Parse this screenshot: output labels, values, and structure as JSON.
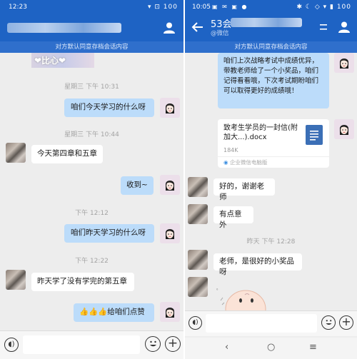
{
  "left": {
    "status": {
      "time": "12:23",
      "icons": "▾ ⊡ 100"
    },
    "banner": "对方默认同意存档会话内容",
    "image_fragment_text": "❤比心❤",
    "messages": [
      {
        "type": "time",
        "text": "星期三 下午 10:31"
      },
      {
        "type": "me",
        "text": "咱们今天学习的什么呀"
      },
      {
        "type": "time",
        "text": "星期三 下午 10:44"
      },
      {
        "type": "them",
        "text": "今天第四章和五章"
      },
      {
        "type": "me",
        "text": "收到~"
      },
      {
        "type": "time",
        "text": "下午 12:12"
      },
      {
        "type": "me",
        "text": "咱们昨天学习的什么呀"
      },
      {
        "type": "time",
        "text": "下午 12:22"
      },
      {
        "type": "them",
        "text": "昨天学了没有学完的第五章"
      },
      {
        "type": "me",
        "text": "👍👍👍给咱们点赞"
      }
    ]
  },
  "right": {
    "status": {
      "time": "10:05",
      "icons": "✱ ☾ ◇ ▾ ▮ 100"
    },
    "title": "53会",
    "subtitle": "@微信",
    "banner": "对方默认同意存档会话内容",
    "messages": [
      {
        "type": "me",
        "text": "咱们上次战略考试中成绩优异，带教老师给了一个小奖品，咱们记得看看哦，下次考试期盼咱们可以取得更好的成绩哦！"
      },
      {
        "type": "file",
        "name": "致考生学员的一封信(附加大...).docx",
        "size": "184K",
        "source": "企业微信电脑版"
      },
      {
        "type": "them",
        "text": "好的，谢谢老师"
      },
      {
        "type": "them",
        "text": "有点意外"
      },
      {
        "type": "time",
        "text": "昨天 下午 12:28"
      },
      {
        "type": "them",
        "text": "老师，是很好的小奖品呀"
      }
    ]
  },
  "colors": {
    "header": "#1e63c4",
    "bubble_me": "#bcdcfa",
    "bubble_them": "#ffffff",
    "chat_bg": "#ededed"
  }
}
